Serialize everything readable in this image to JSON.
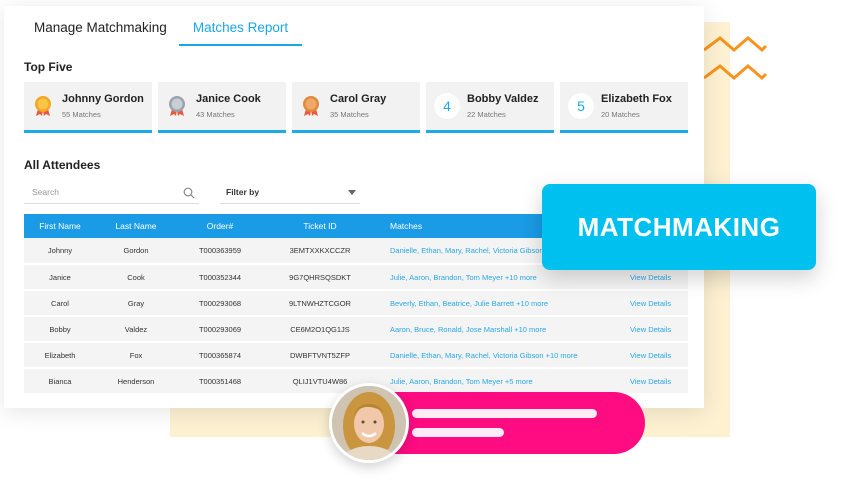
{
  "tabs": [
    {
      "label": "Manage Matchmaking"
    },
    {
      "label": "Matches Report"
    }
  ],
  "top_five": {
    "title": "Top Five",
    "items": [
      {
        "name": "Johnny Gordon",
        "matches": "55 Matches",
        "rank": "1",
        "badge": "gold-medal-icon"
      },
      {
        "name": "Janice Cook",
        "matches": "43 Matches",
        "rank": "2",
        "badge": "silver-medal-icon"
      },
      {
        "name": "Carol Gray",
        "matches": "35 Matches",
        "rank": "3",
        "badge": "bronze-medal-icon"
      },
      {
        "name": "Bobby Valdez",
        "matches": "22 Matches",
        "rank": "4"
      },
      {
        "name": "Elizabeth Fox",
        "matches": "20 Matches",
        "rank": "5"
      }
    ]
  },
  "all_attendees": {
    "title": "All Attendees",
    "search_placeholder": "Search",
    "filter_label": "Filter by",
    "columns": [
      "First Name",
      "Last Name",
      "Order#",
      "Ticket ID",
      "Matches"
    ],
    "rows": [
      {
        "first": "Johnny",
        "last": "Gordon",
        "order": "T000363959",
        "ticket": "3EMTXXKXCCZR",
        "matches": "Danielle, Ethan, Mary, Rachel, Victoria Gibson",
        "details": ""
      },
      {
        "first": "Janice",
        "last": "Cook",
        "order": "T000352344",
        "ticket": "9G7QHRSQSDKT",
        "matches": "Julie, Aaron, Brandon, Tom Meyer +10 more",
        "details": "View Details"
      },
      {
        "first": "Carol",
        "last": "Gray",
        "order": "T000293068",
        "ticket": "9LTNWHZTCGOR",
        "matches": "Beverly, Ethan, Beatrice, Julie Barrett +10 more",
        "details": "View Details"
      },
      {
        "first": "Bobby",
        "last": "Valdez",
        "order": "T000293069",
        "ticket": "CE6M2O1QG1JS",
        "matches": "Aaron, Bruce, Ronald, Jose Marshall +10 more",
        "details": "View Details"
      },
      {
        "first": "Elizabeth",
        "last": "Fox",
        "order": "T000365874",
        "ticket": "DWBFTVNT5ZFP",
        "matches": "Danielle, Ethan, Mary, Rachel, Victoria Gibson +10 more",
        "details": "View Details"
      },
      {
        "first": "Bianca",
        "last": "Henderson",
        "order": "T000351468",
        "ticket": "QLIJ1VTU4W86",
        "matches": "Julie, Aaron, Brandon, Tom Meyer +5 more",
        "details": "View Details"
      }
    ]
  },
  "banner": {
    "label": "MATCHMAKING"
  },
  "colors": {
    "accent": "#1a9be6",
    "banner": "#00c0ef",
    "pink": "#ff0b82",
    "zigzag": "#f7931e",
    "cream": "#fdf1d2"
  }
}
